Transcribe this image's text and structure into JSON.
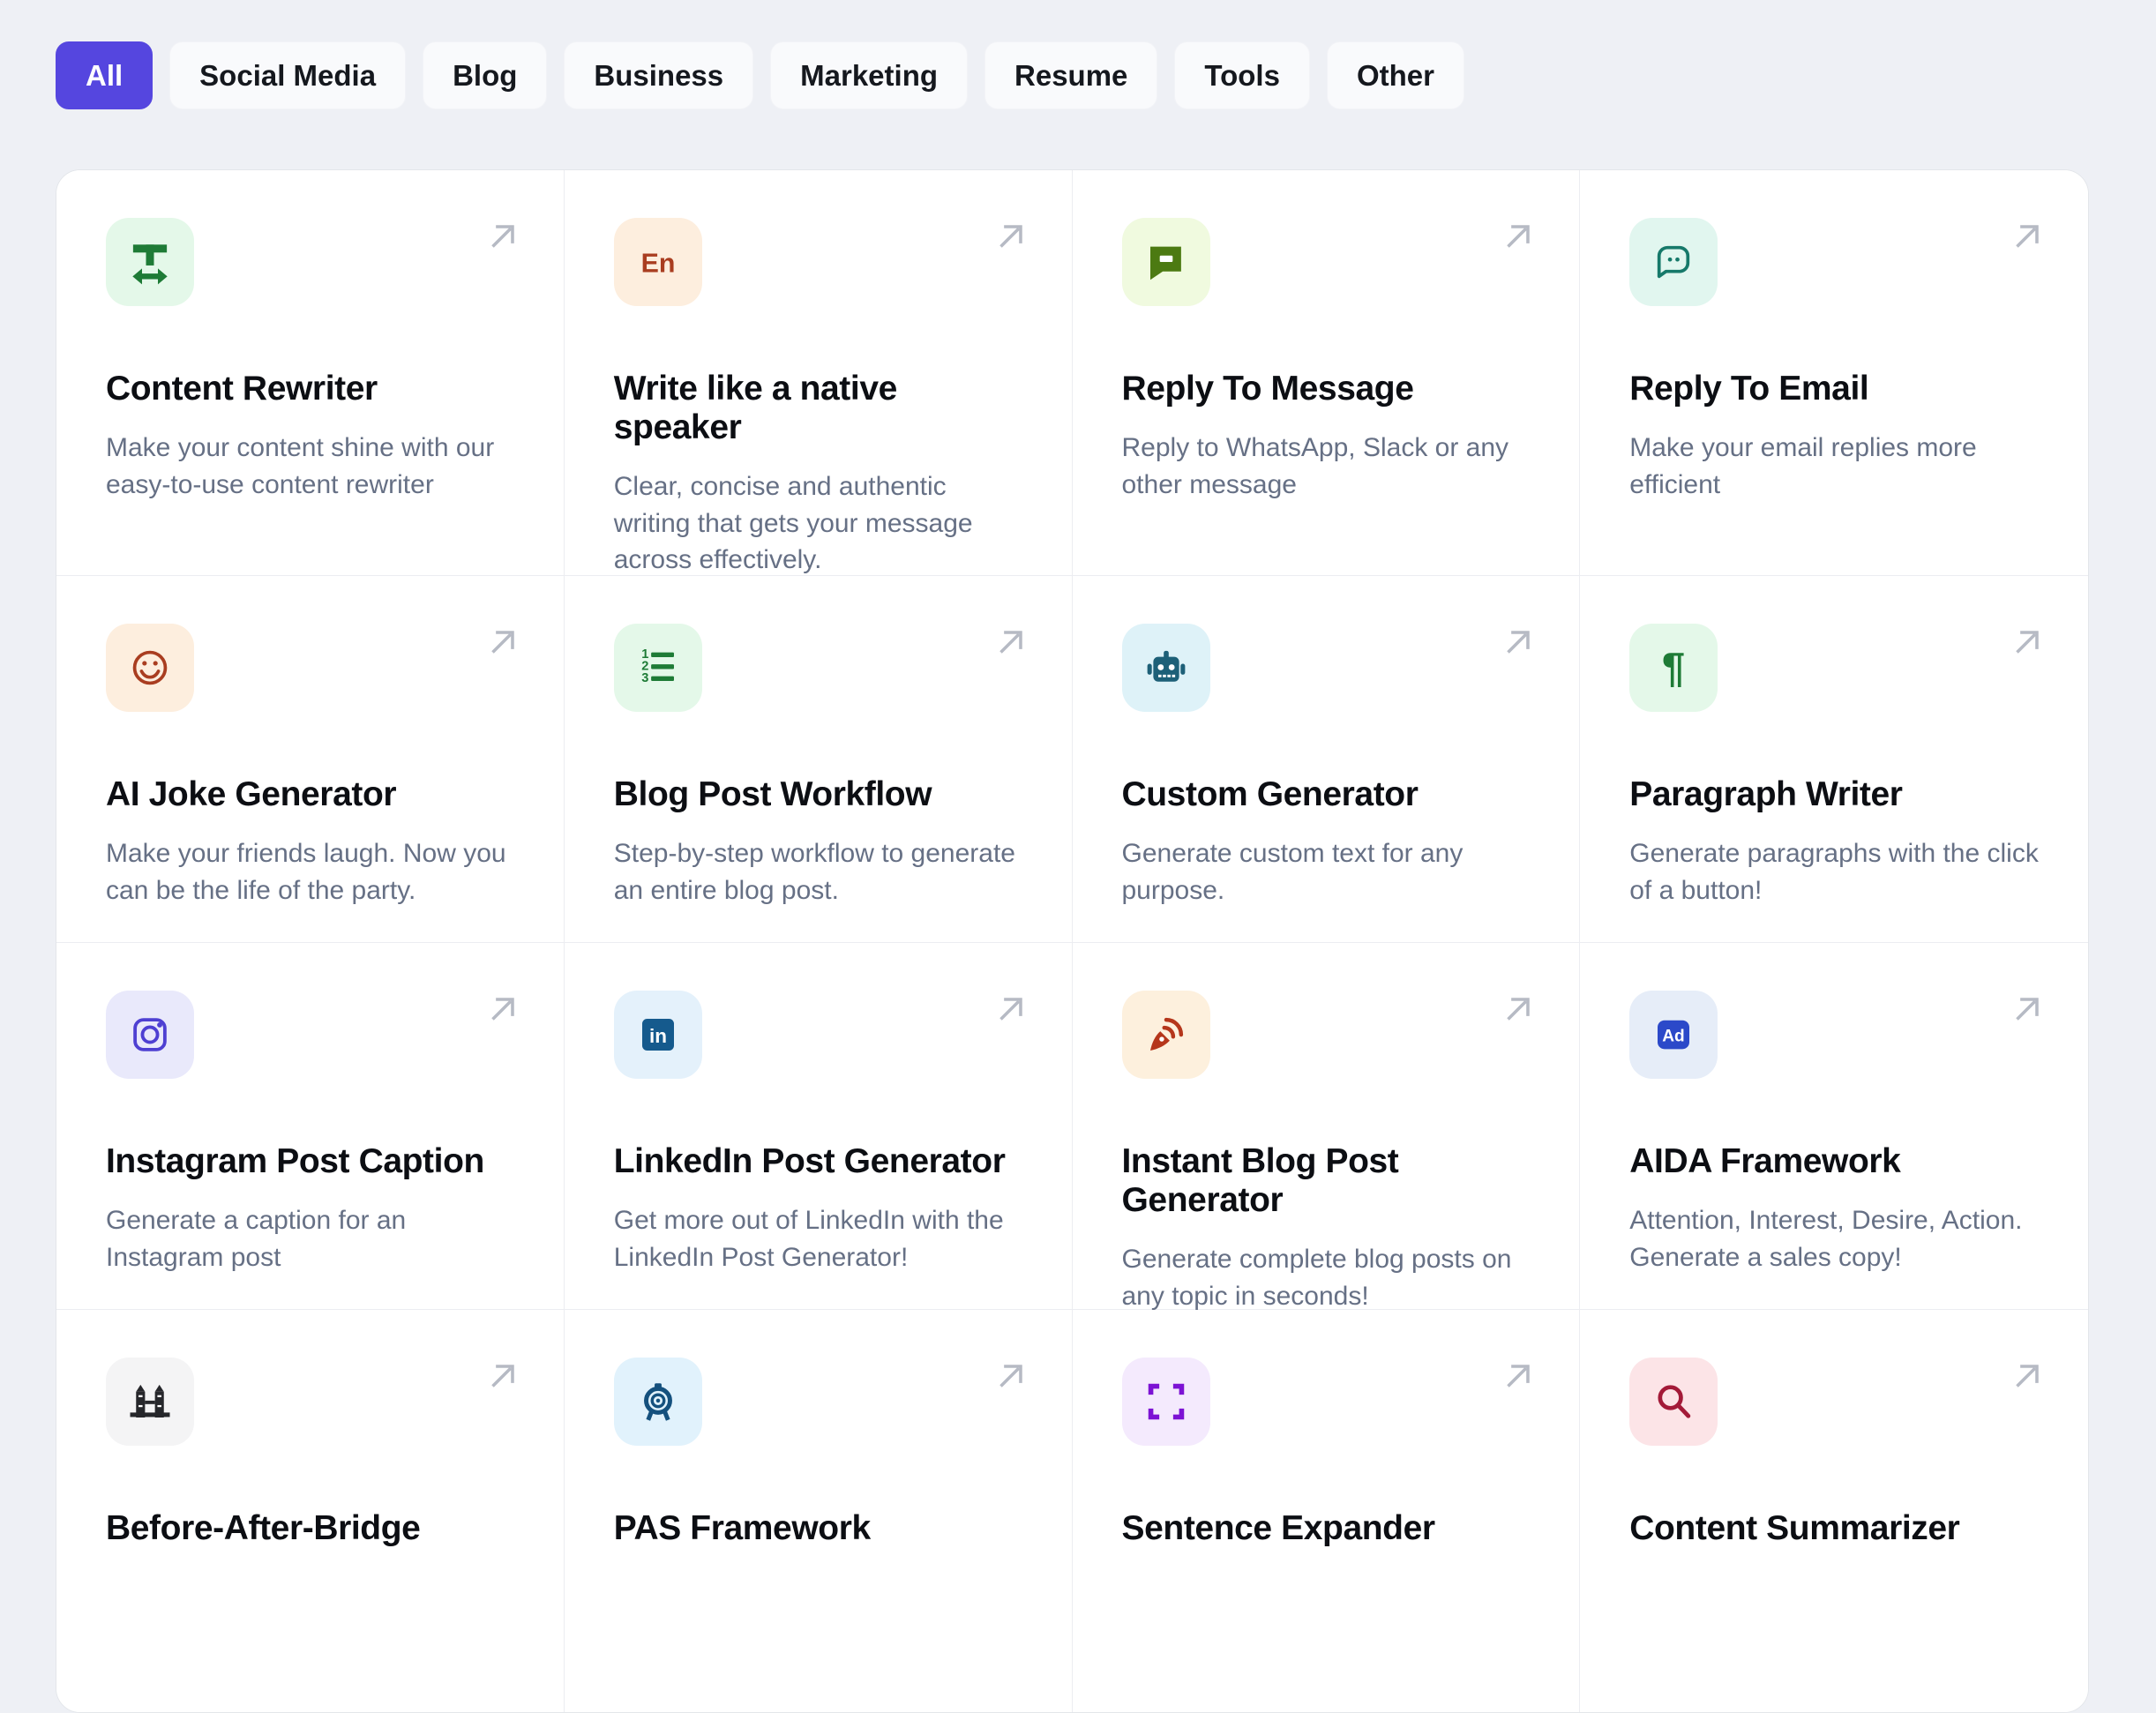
{
  "page": {
    "background": "#eef0f5",
    "card_background": "#ffffff",
    "grid_border": "#e3e6ea",
    "divider": "#ecedf1",
    "accent": "#5546df",
    "title_color": "#0c0e13",
    "description_color": "#667085",
    "arrow_color": "#b6bac4"
  },
  "filters": {
    "items": [
      {
        "label": "All",
        "active": true
      },
      {
        "label": "Social Media",
        "active": false
      },
      {
        "label": "Blog",
        "active": false
      },
      {
        "label": "Business",
        "active": false
      },
      {
        "label": "Marketing",
        "active": false
      },
      {
        "label": "Resume",
        "active": false
      },
      {
        "label": "Tools",
        "active": false
      },
      {
        "label": "Other",
        "active": false
      }
    ]
  },
  "grid": {
    "cards": [
      {
        "title": "Content Rewriter",
        "description": "Make your content shine with our easy-to-use content rewriter",
        "icon": {
          "name": "text-width-icon",
          "bg": "#e4f8e9",
          "color": "#1e7b36"
        }
      },
      {
        "title": "Write like a native speaker",
        "description": "Clear, concise and authentic writing that gets your message across effectively.",
        "icon": {
          "name": "english-letters-icon",
          "bg": "#fdeede",
          "color": "#a93d20",
          "text": "En"
        }
      },
      {
        "title": "Reply To Message",
        "description": "Reply to WhatsApp, Slack or any other message",
        "icon": {
          "name": "message-dash-icon",
          "bg": "#f0fadf",
          "color": "#4c7a12"
        }
      },
      {
        "title": "Reply To Email",
        "description": "Make your email replies more efficient",
        "icon": {
          "name": "message-dots-icon",
          "bg": "#e1f6ef",
          "color": "#16796a"
        }
      },
      {
        "title": "AI Joke Generator",
        "description": "Make your friends laugh. Now you can be the life of the party.",
        "icon": {
          "name": "smiley-icon",
          "bg": "#fdeede",
          "color": "#a93d20"
        }
      },
      {
        "title": "Blog Post Workflow",
        "description": "Step-by-step workflow to generate an entire blog post.",
        "icon": {
          "name": "ordered-list-icon",
          "bg": "#e4f8e9",
          "color": "#1e7b36",
          "digits": [
            "1",
            "2",
            "3"
          ]
        }
      },
      {
        "title": "Custom Generator",
        "description": "Generate custom text for any purpose.",
        "icon": {
          "name": "robot-icon",
          "bg": "#def2f8",
          "color": "#1d6078"
        }
      },
      {
        "title": "Paragraph Writer",
        "description": "Generate paragraphs with the click of a button!",
        "icon": {
          "name": "pilcrow-icon",
          "bg": "#e4f8e9",
          "color": "#1e7b36",
          "text": "¶"
        }
      },
      {
        "title": "Instagram Post Caption",
        "description": "Generate a caption for an Instagram post",
        "icon": {
          "name": "instagram-icon",
          "bg": "#e9e9fb",
          "color": "#4e40d2"
        }
      },
      {
        "title": "LinkedIn Post Generator",
        "description": "Get more out of LinkedIn with the LinkedIn Post Generator!",
        "icon": {
          "name": "linkedin-icon",
          "bg": "#e4f1fb",
          "color": "#155a8d",
          "text": "in"
        }
      },
      {
        "title": "Instant Blog Post Generator",
        "description": "Generate complete blog posts on any topic in seconds!",
        "icon": {
          "name": "pen-feed-icon",
          "bg": "#fdf0dd",
          "color": "#b5361b"
        }
      },
      {
        "title": "AIDA Framework",
        "description": "Attention, Interest, Desire, Action. Generate a sales copy!",
        "icon": {
          "name": "ad-badge-icon",
          "bg": "#e6edf8",
          "color": "#2b49c9",
          "text": "Ad"
        }
      },
      {
        "title": "Before-After-Bridge",
        "description": "",
        "icon": {
          "name": "bridge-icon",
          "bg": "#f4f4f5",
          "color": "#26272b"
        }
      },
      {
        "title": "PAS Framework",
        "description": "",
        "icon": {
          "name": "target-board-icon",
          "bg": "#e1f2fc",
          "color": "#15517e"
        }
      },
      {
        "title": "Sentence Expander",
        "description": "",
        "icon": {
          "name": "expand-icon",
          "bg": "#f4eafd",
          "color": "#7c12d4"
        }
      },
      {
        "title": "Content Summarizer",
        "description": "",
        "icon": {
          "name": "search-icon",
          "bg": "#fce4e7",
          "color": "#a31a38"
        }
      }
    ]
  }
}
